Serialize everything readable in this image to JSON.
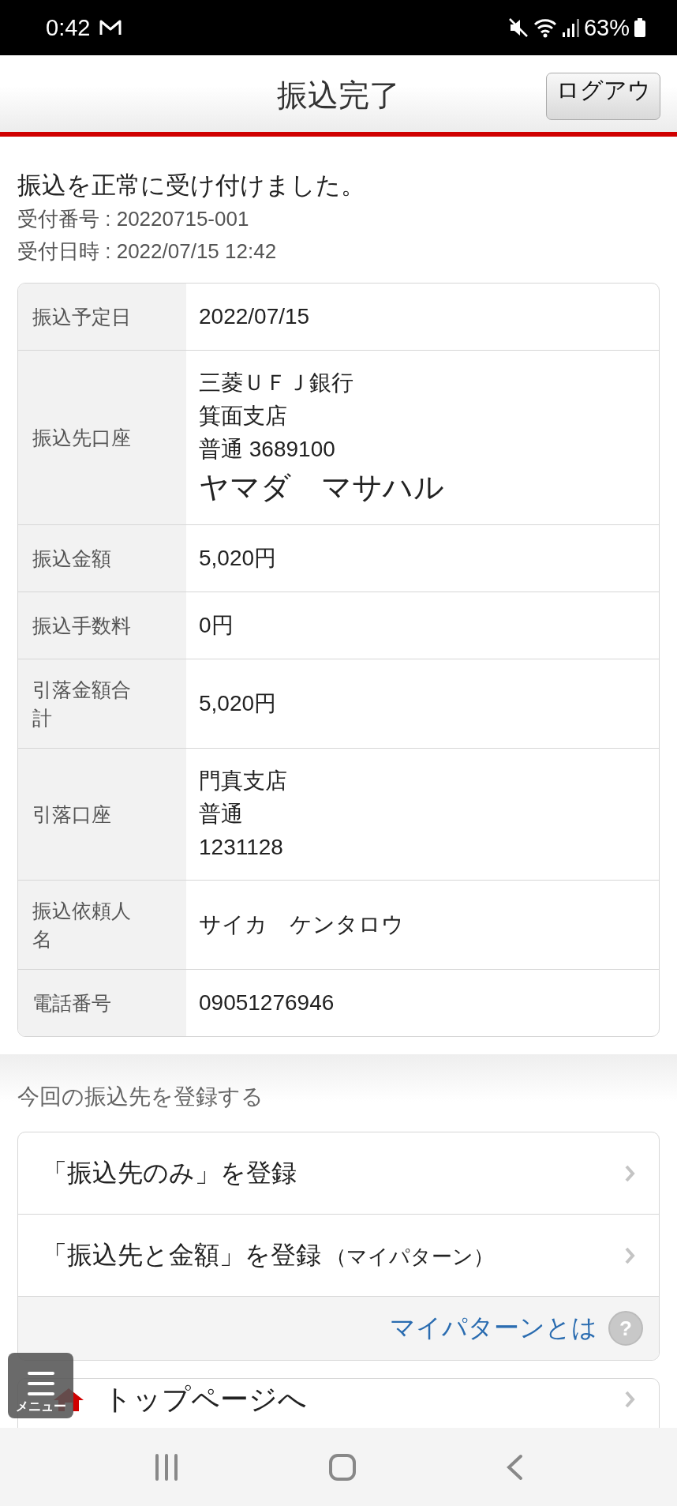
{
  "status_bar": {
    "time": "0:42",
    "battery": "63%"
  },
  "header": {
    "title": "振込完了",
    "logout_button": "ログアウ"
  },
  "message": "振込を正常に受け付けました。",
  "receipt": [
    "受付番号 : 20220715-001",
    "受付日時 : 2022/07/15 12:42"
  ],
  "details": [
    {
      "label": "振込予定日",
      "lines": [
        {
          "text": "2022/07/15",
          "kind": "plain"
        }
      ]
    },
    {
      "label": "振込先口座",
      "lines": [
        {
          "text": "三菱ＵＦＪ銀行",
          "kind": "plain"
        },
        {
          "text": "箕面支店",
          "kind": "plain"
        },
        {
          "text": "普通 3689100",
          "kind": "plain"
        },
        {
          "text": "ヤマダ　マサハル",
          "kind": "name"
        }
      ]
    },
    {
      "label": "振込金額",
      "lines": [
        {
          "text": "5,020円",
          "kind": "plain"
        }
      ]
    },
    {
      "label": "振込手数料",
      "lines": [
        {
          "text": "0円",
          "kind": "plain"
        }
      ]
    },
    {
      "label": "引落金額合計",
      "lines": [
        {
          "text": "5,020円",
          "kind": "plain"
        }
      ]
    },
    {
      "label": "引落口座",
      "lines": [
        {
          "text": "門真支店",
          "kind": "plain"
        },
        {
          "text": "普通",
          "kind": "plain"
        },
        {
          "text": "1231128",
          "kind": "plain"
        }
      ]
    },
    {
      "label": "振込依頼人名",
      "lines": [
        {
          "text": "サイカ　ケンタロウ",
          "kind": "plain"
        }
      ]
    },
    {
      "label": "電話番号",
      "lines": [
        {
          "text": "09051276946",
          "kind": "plain"
        }
      ]
    }
  ],
  "register": {
    "heading": "今回の振込先を登録する",
    "items": [
      {
        "label": "「振込先のみ」を登録"
      },
      {
        "label": "「振込先と金額」を登録",
        "note": "（マイパターン）"
      }
    ],
    "help_link": "マイパターンとは",
    "help_icon": "?"
  },
  "top_page_link": "トップページへ",
  "menu_button": "メニュー"
}
